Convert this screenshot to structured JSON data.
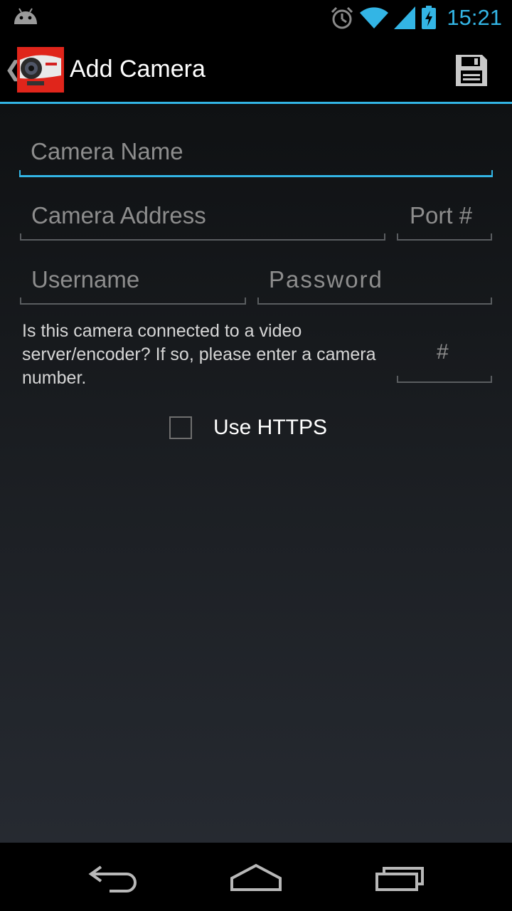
{
  "status_bar": {
    "time": "15:21",
    "icons": [
      "android-notification-icon",
      "alarm-icon",
      "wifi-icon",
      "signal-icon",
      "battery-charging-icon"
    ],
    "accent": "#33b5e5"
  },
  "action_bar": {
    "title": "Add Camera",
    "app_icon": "camera-app-icon",
    "save_icon": "save-icon"
  },
  "form": {
    "camera_name": {
      "value": "",
      "placeholder": "Camera Name"
    },
    "camera_address": {
      "value": "",
      "placeholder": "Camera Address"
    },
    "port": {
      "value": "",
      "placeholder": "Port #"
    },
    "username": {
      "value": "",
      "placeholder": "Username"
    },
    "password": {
      "value": "",
      "placeholder": "Password"
    },
    "camera_number_question": "Is this camera connected to a video server/encoder? If so, please enter a camera number.",
    "camera_number": {
      "value": "",
      "placeholder": "#"
    },
    "use_https": {
      "label": "Use HTTPS",
      "checked": false
    }
  },
  "nav_bar": {
    "icons": [
      "back-icon",
      "home-icon",
      "recent-apps-icon"
    ]
  },
  "colors": {
    "accent": "#33b5e5",
    "brand_red": "#e0251b"
  }
}
